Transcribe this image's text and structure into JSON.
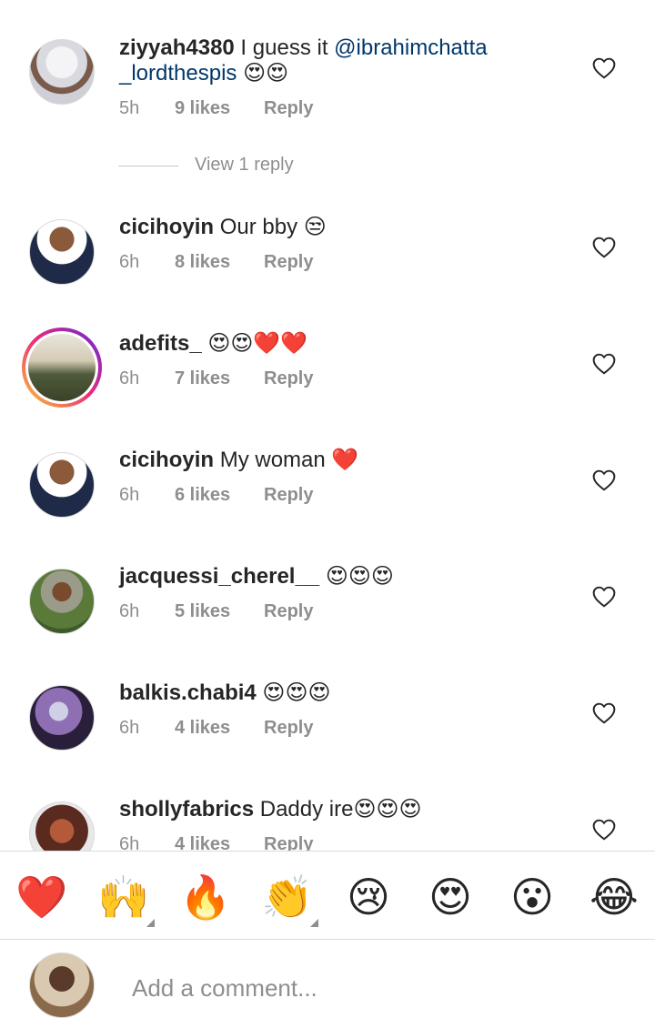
{
  "comments": [
    {
      "username": "ziyyah4380",
      "text_before": " I guess it ",
      "mention": "@ibrahimchatta _lordthespis",
      "text_after": " 😍😍",
      "time": "5h",
      "likes": "9 likes",
      "reply": "Reply"
    },
    {
      "username": "cicihoyin",
      "text": " Our bby 😒",
      "time": "6h",
      "likes": "8 likes",
      "reply": "Reply"
    },
    {
      "username": "adefits_",
      "text": " 😍😍❤️❤️",
      "time": "6h",
      "likes": "7 likes",
      "reply": "Reply"
    },
    {
      "username": "cicihoyin",
      "text": " My woman ❤️",
      "time": "6h",
      "likes": "6 likes",
      "reply": "Reply"
    },
    {
      "username": "jacquessi_cherel__",
      "text": " 😍😍😍",
      "time": "6h",
      "likes": "5 likes",
      "reply": "Reply"
    },
    {
      "username": "balkis.chabi4",
      "text": " 😍😍😍",
      "time": "6h",
      "likes": "4 likes",
      "reply": "Reply"
    },
    {
      "username": "shollyfabrics",
      "text": " Daddy ire😍😍😍",
      "time": "6h",
      "likes": "4 likes",
      "reply": "Reply"
    }
  ],
  "view_replies": "View 1 reply",
  "reactions": [
    "❤️",
    "🙌",
    "🔥",
    "👏",
    "😢",
    "😍",
    "😮",
    "😂"
  ],
  "add_comment": {
    "placeholder": "Add a comment..."
  },
  "colors": {
    "mention": "#00376b",
    "secondary_text": "#8e8e8e",
    "heart_outline": "#262626"
  }
}
